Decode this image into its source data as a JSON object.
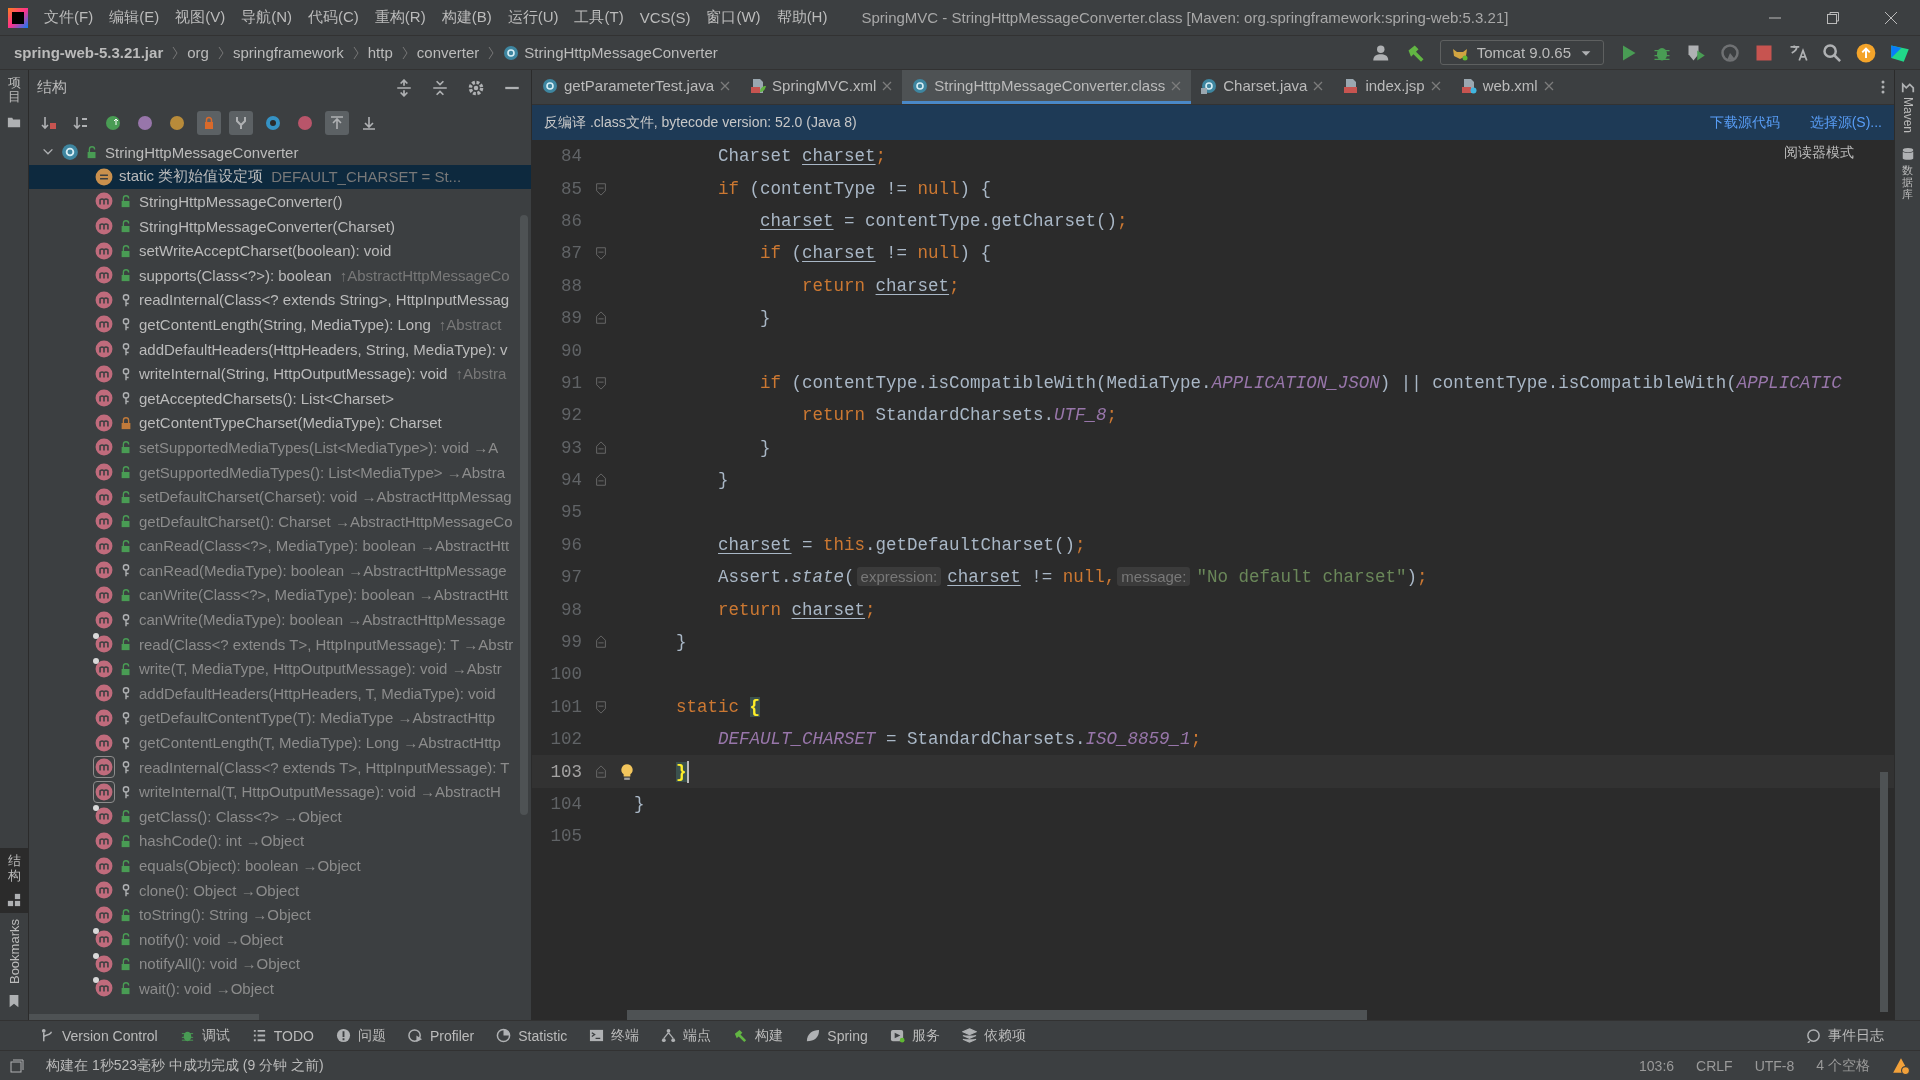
{
  "menubar": {
    "menus": [
      "文件(F)",
      "编辑(E)",
      "视图(V)",
      "导航(N)",
      "代码(C)",
      "重构(R)",
      "构建(B)",
      "运行(U)",
      "工具(T)",
      "VCS(S)",
      "窗口(W)",
      "帮助(H)"
    ],
    "title": "SpringMVC - StringHttpMessageConverter.class [Maven: org.springframework:spring-web:5.3.21]"
  },
  "breadcrumbs": [
    {
      "label": "spring-web-5.3.21.jar",
      "kind": "jar"
    },
    {
      "label": "org",
      "kind": "package"
    },
    {
      "label": "springframework",
      "kind": "package"
    },
    {
      "label": "http",
      "kind": "package"
    },
    {
      "label": "converter",
      "kind": "package"
    },
    {
      "label": "StringHttpMessageConverter",
      "kind": "class"
    }
  ],
  "run_toolbar": {
    "before": [
      {
        "kind": "user"
      },
      {
        "kind": "build"
      }
    ],
    "run_config": "Tomcat 9.0.65",
    "after": [
      {
        "kind": "run"
      },
      {
        "kind": "debug"
      },
      {
        "kind": "coverage"
      },
      {
        "kind": "profile"
      },
      {
        "kind": "stop"
      },
      {
        "kind": "translate"
      },
      {
        "kind": "search"
      },
      {
        "kind": "update"
      },
      {
        "kind": "toolbox"
      }
    ]
  },
  "left_stripe": [
    {
      "label": "项目",
      "selected": false
    },
    {
      "label": "结构",
      "selected": true
    },
    {
      "label": "Bookmarks",
      "selected": false
    }
  ],
  "structure": {
    "title": "结构",
    "toolbar": [
      {
        "kind": "sort-visibility",
        "on": false
      },
      {
        "kind": "sort-alpha",
        "on": false
      },
      {
        "kind": "inherited",
        "on": false
      },
      {
        "kind": "properties",
        "on": false
      },
      {
        "kind": "fields",
        "on": false
      },
      {
        "kind": "non-public",
        "on": true
      },
      {
        "kind": "anonymous",
        "on": true
      },
      {
        "kind": "interfaces",
        "on": false
      },
      {
        "kind": "lambdas",
        "on": false
      },
      {
        "kind": "autoscroll-to",
        "on": true
      },
      {
        "kind": "autoscroll-from",
        "on": false
      }
    ],
    "root": {
      "name": "StringHttpMessageConverter",
      "expanded": true,
      "selected": false,
      "children": [
        {
          "kind": "initializer",
          "name": "static 类初始值设定项",
          "origin": "DEFAULT_CHARSET = St...",
          "inherited": false,
          "final": false,
          "abstract": false,
          "selected": true
        },
        {
          "kind": "public-method",
          "name": "StringHttpMessageConverter()",
          "inherited": false,
          "final": false,
          "abstract": false,
          "selected": false
        },
        {
          "kind": "public-method",
          "name": "StringHttpMessageConverter(Charset)",
          "inherited": false,
          "final": false,
          "abstract": false,
          "selected": false
        },
        {
          "kind": "public-method",
          "name": "setWriteAcceptCharset(boolean): void",
          "inherited": false,
          "final": false,
          "abstract": false,
          "selected": false
        },
        {
          "kind": "public-method",
          "name": "supports(Class<?>): boolean",
          "origin": "↑AbstractHttpMessageCo",
          "inherited": false,
          "final": false,
          "abstract": false,
          "selected": false
        },
        {
          "kind": "protected-method",
          "name": "readInternal(Class<? extends String>, HttpInputMessag",
          "inherited": false,
          "final": false,
          "abstract": false,
          "selected": false
        },
        {
          "kind": "protected-method",
          "name": "getContentLength(String, MediaType): Long",
          "origin": "↑Abstract",
          "inherited": false,
          "final": false,
          "abstract": false,
          "selected": false
        },
        {
          "kind": "protected-method",
          "name": "addDefaultHeaders(HttpHeaders, String, MediaType): v",
          "inherited": false,
          "final": false,
          "abstract": false,
          "selected": false
        },
        {
          "kind": "protected-method",
          "name": "writeInternal(String, HttpOutputMessage): void",
          "origin": "↑Abstra",
          "inherited": false,
          "final": false,
          "abstract": false,
          "selected": false
        },
        {
          "kind": "protected-method",
          "name": "getAcceptedCharsets(): List<Charset>",
          "inherited": false,
          "final": false,
          "abstract": false,
          "selected": false
        },
        {
          "kind": "private-method",
          "name": "getContentTypeCharset(MediaType): Charset",
          "inherited": false,
          "final": false,
          "abstract": false,
          "selected": false
        },
        {
          "kind": "public-method",
          "name": "setSupportedMediaTypes(List<MediaType>): void →A",
          "inherited": true,
          "final": false,
          "abstract": false,
          "selected": false
        },
        {
          "kind": "public-method",
          "name": "getSupportedMediaTypes(): List<MediaType> →Abstra",
          "inherited": true,
          "final": false,
          "abstract": false,
          "selected": false
        },
        {
          "kind": "public-method",
          "name": "setDefaultCharset(Charset): void →AbstractHttpMessag",
          "inherited": true,
          "final": false,
          "abstract": false,
          "selected": false
        },
        {
          "kind": "public-method",
          "name": "getDefaultCharset(): Charset →AbstractHttpMessageCo",
          "inherited": true,
          "final": false,
          "abstract": false,
          "selected": false
        },
        {
          "kind": "public-method",
          "name": "canRead(Class<?>, MediaType): boolean →AbstractHtt",
          "inherited": true,
          "final": false,
          "abstract": false,
          "selected": false
        },
        {
          "kind": "protected-method",
          "name": "canRead(MediaType): boolean →AbstractHttpMessage",
          "inherited": true,
          "final": false,
          "abstract": false,
          "selected": false
        },
        {
          "kind": "public-method",
          "name": "canWrite(Class<?>, MediaType): boolean →AbstractHtt",
          "inherited": true,
          "final": false,
          "abstract": false,
          "selected": false
        },
        {
          "kind": "protected-method",
          "name": "canWrite(MediaType): boolean →AbstractHttpMessage",
          "inherited": true,
          "final": false,
          "abstract": false,
          "selected": false
        },
        {
          "kind": "public-method",
          "name": "read(Class<? extends T>, HttpInputMessage): T →Abstr",
          "inherited": true,
          "final": true,
          "abstract": false,
          "selected": false
        },
        {
          "kind": "public-method",
          "name": "write(T, MediaType, HttpOutputMessage): void →Abstr",
          "inherited": true,
          "final": true,
          "abstract": false,
          "selected": false
        },
        {
          "kind": "protected-method",
          "name": "addDefaultHeaders(HttpHeaders, T, MediaType): void",
          "inherited": true,
          "final": false,
          "abstract": false,
          "selected": false
        },
        {
          "kind": "protected-method",
          "name": "getDefaultContentType(T): MediaType →AbstractHttp",
          "inherited": true,
          "final": false,
          "abstract": false,
          "selected": false
        },
        {
          "kind": "protected-method",
          "name": "getContentLength(T, MediaType): Long →AbstractHttp",
          "inherited": true,
          "final": false,
          "abstract": false,
          "selected": false
        },
        {
          "kind": "protected-method",
          "name": "readInternal(Class<? extends T>, HttpInputMessage): T",
          "inherited": true,
          "final": false,
          "abstract": true,
          "selected": false
        },
        {
          "kind": "protected-method",
          "name": "writeInternal(T, HttpOutputMessage): void →AbstractH",
          "inherited": true,
          "final": false,
          "abstract": true,
          "selected": false
        },
        {
          "kind": "public-method",
          "name": "getClass(): Class<?> →Object",
          "inherited": true,
          "final": true,
          "abstract": false,
          "selected": false
        },
        {
          "kind": "public-method",
          "name": "hashCode(): int →Object",
          "inherited": true,
          "final": false,
          "abstract": false,
          "selected": false
        },
        {
          "kind": "public-method",
          "name": "equals(Object): boolean →Object",
          "inherited": true,
          "final": false,
          "abstract": false,
          "selected": false
        },
        {
          "kind": "protected-method",
          "name": "clone(): Object →Object",
          "inherited": true,
          "final": false,
          "abstract": false,
          "selected": false
        },
        {
          "kind": "public-method",
          "name": "toString(): String →Object",
          "inherited": true,
          "final": false,
          "abstract": false,
          "selected": false
        },
        {
          "kind": "public-method",
          "name": "notify(): void →Object",
          "inherited": true,
          "final": true,
          "abstract": false,
          "selected": false
        },
        {
          "kind": "public-method",
          "name": "notifyAll(): void →Object",
          "inherited": true,
          "final": true,
          "abstract": false,
          "selected": false
        },
        {
          "kind": "public-method",
          "name": "wait(): void →Object",
          "inherited": true,
          "final": true,
          "abstract": false,
          "selected": false
        }
      ]
    }
  },
  "editor": {
    "tabs": [
      {
        "label": "getParameterTest.java",
        "kind": "java",
        "selected": false
      },
      {
        "label": "SpringMVC.xml",
        "kind": "xml",
        "selected": false
      },
      {
        "label": "StringHttpMessageConverter.class",
        "kind": "class",
        "selected": true
      },
      {
        "label": "Charset.java",
        "kind": "java-lib",
        "selected": false
      },
      {
        "label": "index.jsp",
        "kind": "jsp",
        "selected": false
      },
      {
        "label": "web.xml",
        "kind": "web-xml",
        "selected": false
      }
    ],
    "banner": {
      "message": "反编译 .class文件, bytecode version: 52.0 (Java 8)",
      "links": [
        "下载源代码",
        "选择源(S)..."
      ]
    },
    "reader_mode": "阅读器模式",
    "lines": [
      {
        "number": "84",
        "fold_start": false,
        "fold_end": false,
        "bulb": false,
        "current": false,
        "tokens": [
          {
            "kind": "plain",
            "text": "        Charset "
          },
          {
            "kind": "var",
            "text": "charset"
          },
          {
            "kind": "keyword",
            "text": ";"
          }
        ]
      },
      {
        "number": "85",
        "fold_start": true,
        "fold_end": false,
        "bulb": false,
        "current": false,
        "tokens": [
          {
            "kind": "keyword",
            "text": "        if"
          },
          {
            "kind": "plain",
            "text": " (contentType != "
          },
          {
            "kind": "keyword",
            "text": "null"
          },
          {
            "kind": "plain",
            "text": ") {"
          }
        ]
      },
      {
        "number": "86",
        "fold_start": false,
        "fold_end": false,
        "bulb": false,
        "current": false,
        "tokens": [
          {
            "kind": "var",
            "text": "            charset"
          },
          {
            "kind": "plain",
            "text": " = contentType.getCharset()"
          },
          {
            "kind": "keyword",
            "text": ";"
          }
        ]
      },
      {
        "number": "87",
        "fold_start": true,
        "fold_end": false,
        "bulb": false,
        "current": false,
        "tokens": [
          {
            "kind": "keyword",
            "text": "            if"
          },
          {
            "kind": "plain",
            "text": " ("
          },
          {
            "kind": "var",
            "text": "charset"
          },
          {
            "kind": "plain",
            "text": " != "
          },
          {
            "kind": "keyword",
            "text": "null"
          },
          {
            "kind": "plain",
            "text": ") {"
          }
        ]
      },
      {
        "number": "88",
        "fold_start": false,
        "fold_end": false,
        "bulb": false,
        "current": false,
        "tokens": [
          {
            "kind": "keyword",
            "text": "                return "
          },
          {
            "kind": "var",
            "text": "charset"
          },
          {
            "kind": "keyword",
            "text": ";"
          }
        ]
      },
      {
        "number": "89",
        "fold_start": false,
        "fold_end": true,
        "bulb": false,
        "current": false,
        "tokens": [
          {
            "kind": "plain",
            "text": "            }"
          }
        ]
      },
      {
        "number": "90",
        "fold_start": false,
        "fold_end": false,
        "bulb": false,
        "current": false
      },
      {
        "number": "91",
        "fold_start": true,
        "fold_end": false,
        "bulb": false,
        "current": false,
        "tokens": [
          {
            "kind": "keyword",
            "text": "            if"
          },
          {
            "kind": "plain",
            "text": " (contentType.isCompatibleWith(MediaType."
          },
          {
            "kind": "const",
            "text": "APPLICATION_JSON"
          },
          {
            "kind": "plain",
            "text": ") || contentType.isCompatibleWith("
          },
          {
            "kind": "const",
            "text": "APPLICATIC"
          }
        ]
      },
      {
        "number": "92",
        "fold_start": false,
        "fold_end": false,
        "bulb": false,
        "current": false,
        "tokens": [
          {
            "kind": "keyword",
            "text": "                return "
          },
          {
            "kind": "plain",
            "text": "StandardCharsets."
          },
          {
            "kind": "const",
            "text": "UTF_8"
          },
          {
            "kind": "keyword",
            "text": ";"
          }
        ]
      },
      {
        "number": "93",
        "fold_start": false,
        "fold_end": true,
        "bulb": false,
        "current": false,
        "tokens": [
          {
            "kind": "plain",
            "text": "            }"
          }
        ]
      },
      {
        "number": "94",
        "fold_start": false,
        "fold_end": true,
        "bulb": false,
        "current": false,
        "tokens": [
          {
            "kind": "plain",
            "text": "        }"
          }
        ]
      },
      {
        "number": "95",
        "fold_start": false,
        "fold_end": false,
        "bulb": false,
        "current": false
      },
      {
        "number": "96",
        "fold_start": false,
        "fold_end": false,
        "bulb": false,
        "current": false,
        "tokens": [
          {
            "kind": "var",
            "text": "        charset"
          },
          {
            "kind": "plain",
            "text": " = "
          },
          {
            "kind": "keyword",
            "text": "this"
          },
          {
            "kind": "plain",
            "text": ".getDefaultCharset()"
          },
          {
            "kind": "keyword",
            "text": ";"
          }
        ]
      },
      {
        "number": "97",
        "fold_start": false,
        "fold_end": false,
        "bulb": false,
        "current": false,
        "tokens": [
          {
            "kind": "plain",
            "text": "        Assert."
          },
          {
            "kind": "static",
            "text": "state"
          },
          {
            "kind": "plain",
            "text": "("
          },
          {
            "kind": "hint",
            "text": "expression:"
          },
          {
            "kind": "var",
            "text": "charset"
          },
          {
            "kind": "plain",
            "text": " != "
          },
          {
            "kind": "keyword",
            "text": "null"
          },
          {
            "kind": "keyword",
            "text": ","
          },
          {
            "kind": "hint",
            "text": "message:"
          },
          {
            "kind": "string",
            "text": "\"No default charset\""
          },
          {
            "kind": "plain",
            "text": ")"
          },
          {
            "kind": "keyword",
            "text": ";"
          }
        ]
      },
      {
        "number": "98",
        "fold_start": false,
        "fold_end": false,
        "bulb": false,
        "current": false,
        "tokens": [
          {
            "kind": "keyword",
            "text": "        return "
          },
          {
            "kind": "var",
            "text": "charset"
          },
          {
            "kind": "keyword",
            "text": ";"
          }
        ]
      },
      {
        "number": "99",
        "fold_start": false,
        "fold_end": true,
        "bulb": false,
        "current": false,
        "tokens": [
          {
            "kind": "plain",
            "text": "    }"
          }
        ]
      },
      {
        "number": "100",
        "fold_start": false,
        "fold_end": false,
        "bulb": false,
        "current": false
      },
      {
        "number": "101",
        "fold_start": true,
        "fold_end": false,
        "bulb": false,
        "current": false,
        "tokens": [
          {
            "kind": "keyword",
            "text": "    static "
          },
          {
            "kind": "brace",
            "text": "{"
          }
        ]
      },
      {
        "number": "102",
        "fold_start": false,
        "fold_end": false,
        "bulb": false,
        "current": false,
        "tokens": [
          {
            "kind": "const",
            "text": "        DEFAULT_CHARSET"
          },
          {
            "kind": "plain",
            "text": " = StandardCharsets."
          },
          {
            "kind": "const",
            "text": "ISO_8859_1"
          },
          {
            "kind": "keyword",
            "text": ";"
          }
        ]
      },
      {
        "number": "103",
        "fold_start": false,
        "fold_end": true,
        "bulb": true,
        "current": true,
        "tokens": [
          {
            "kind": "brace",
            "text": "    }"
          }
        ]
      },
      {
        "number": "104",
        "fold_start": false,
        "fold_end": false,
        "bulb": false,
        "current": false,
        "tokens": [
          {
            "kind": "plain",
            "text": "}"
          }
        ]
      },
      {
        "number": "105",
        "fold_start": false,
        "fold_end": false,
        "bulb": false,
        "current": false
      }
    ]
  },
  "right_stripe": [
    {
      "label": "Maven",
      "kind": "maven"
    },
    {
      "label": "数据库",
      "kind": "database"
    }
  ],
  "tool_windows": [
    {
      "label": "Version Control",
      "kind": "vcs"
    },
    {
      "label": "调试",
      "kind": "debug"
    },
    {
      "label": "TODO",
      "kind": "list"
    },
    {
      "label": "问题",
      "kind": "problems"
    },
    {
      "label": "Profiler",
      "kind": "profiler"
    },
    {
      "label": "Statistic",
      "kind": "statistic"
    },
    {
      "label": "终端",
      "kind": "terminal"
    },
    {
      "label": "端点",
      "kind": "endpoints"
    },
    {
      "label": "构建",
      "kind": "build"
    },
    {
      "label": "Spring",
      "kind": "spring"
    },
    {
      "label": "服务",
      "kind": "services"
    },
    {
      "label": "依赖项",
      "kind": "dependencies"
    }
  ],
  "event_log": "事件日志",
  "status_bar": {
    "message": "构建在 1秒523毫秒 中成功完成 (9 分钟 之前)",
    "items": [
      "103:6",
      "CRLF",
      "UTF-8",
      "4 个空格"
    ]
  }
}
